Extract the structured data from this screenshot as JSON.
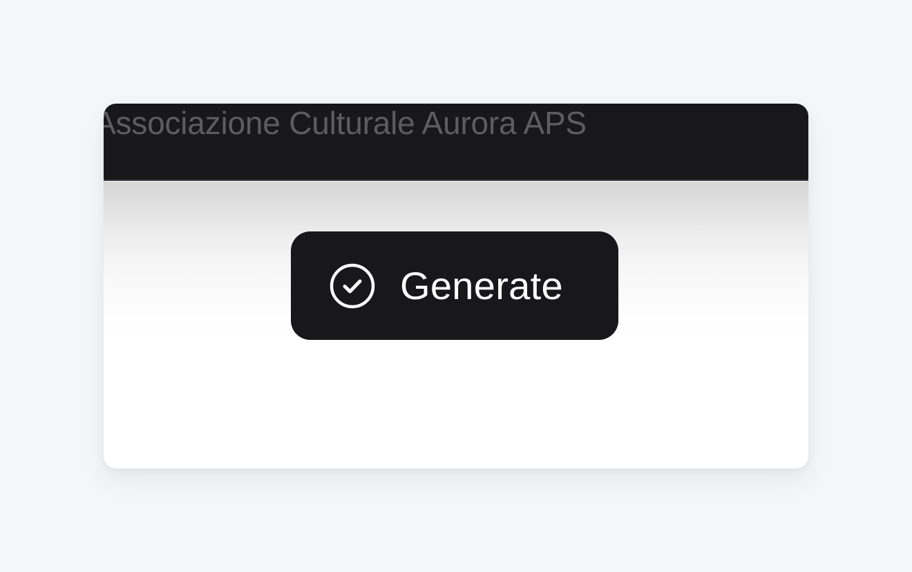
{
  "header": {
    "organization_name": "Associazione Culturale Aurora APS"
  },
  "actions": {
    "generate_label": "Generate",
    "generate_icon": "check-circle-icon"
  },
  "colors": {
    "page_background": "#f5f6f8",
    "topbar_background": "#18181b",
    "button_background": "#18181b",
    "button_text": "#ffffff",
    "title_text": "#5c5c61"
  }
}
